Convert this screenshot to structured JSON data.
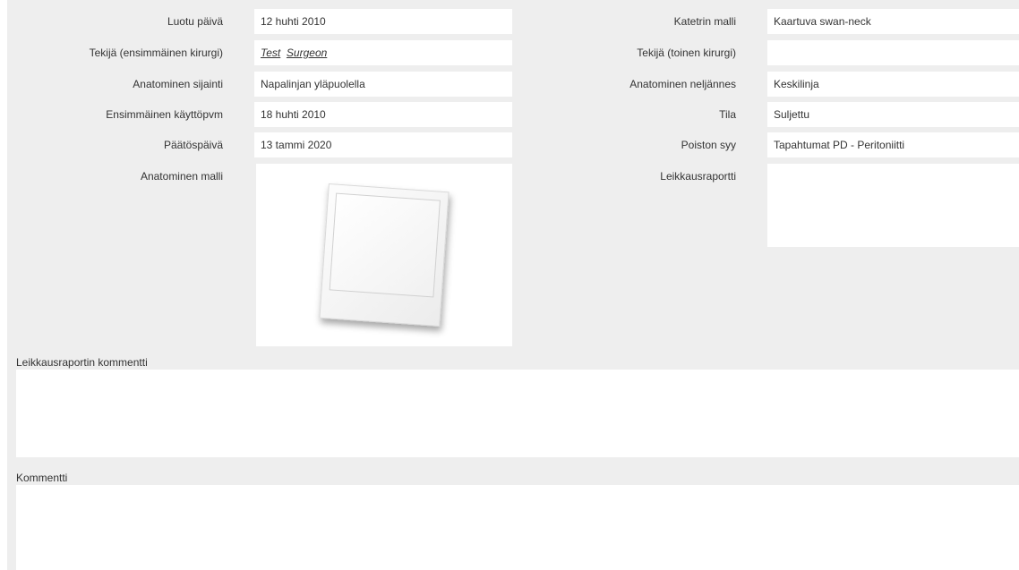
{
  "form": {
    "left": [
      {
        "label": "Luotu päivä",
        "value": "12 huhti 2010"
      },
      {
        "label": "Tekijä (ensimmäinen kirurgi)",
        "value_first": "Test",
        "value_last": "Surgeon"
      },
      {
        "label": "Anatominen sijainti",
        "value": "Napalinjan yläpuolella"
      },
      {
        "label": "Ensimmäinen käyttöpvm",
        "value": "18 huhti 2010"
      },
      {
        "label": "Päätöspäivä",
        "value": "13 tammi 2020"
      },
      {
        "label": "Anatominen malli"
      }
    ],
    "right": [
      {
        "label": "Katetrin malli",
        "value": "Kaartuva swan-neck"
      },
      {
        "label": "Tekijä (toinen kirurgi)",
        "value": ""
      },
      {
        "label": "Anatominen neljännes",
        "value": "Keskilinja"
      },
      {
        "label": "Tila",
        "value": "Suljettu"
      },
      {
        "label": "Poiston syy",
        "value": "Tapahtumat PD - Peritoniitti"
      },
      {
        "label": "Leikkausraportti",
        "value": ""
      }
    ]
  },
  "surgery_report_comment": {
    "label": "Leikkausraportin kommentti",
    "value": ""
  },
  "comment": {
    "label": "Kommentti",
    "value": ""
  },
  "icons": {
    "anatomical_model": "photo-placeholder-icon"
  }
}
